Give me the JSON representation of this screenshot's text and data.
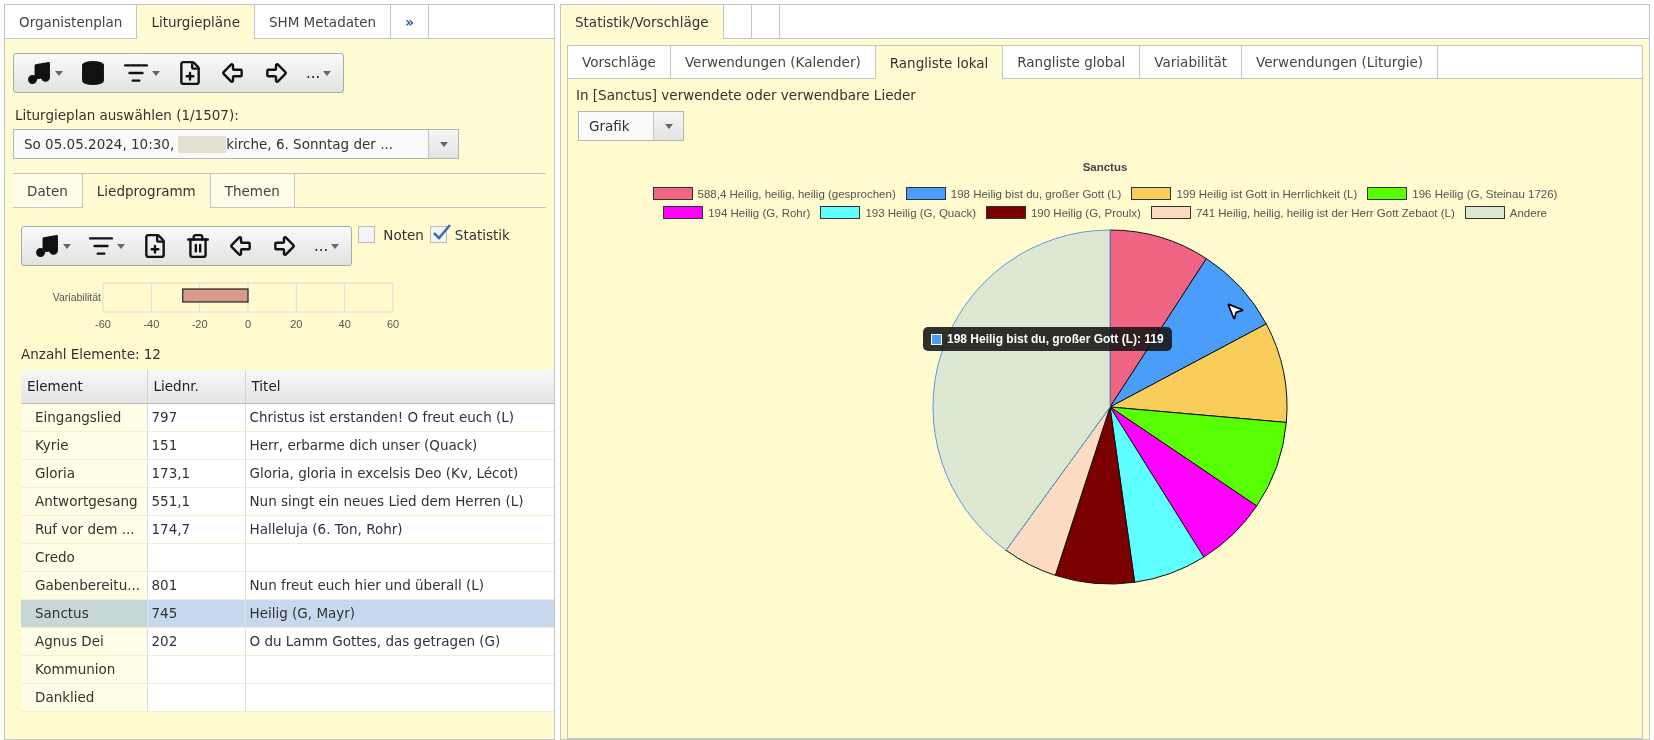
{
  "left": {
    "tabs": [
      {
        "label": "Organistenplan",
        "selected": false
      },
      {
        "label": "Liturgiepläne",
        "selected": true
      },
      {
        "label": "SHM Metadaten",
        "selected": false
      },
      {
        "label": "»",
        "selected": false
      }
    ],
    "toolbar": [
      {
        "kind": "music",
        "dropdown": true
      },
      {
        "kind": "database",
        "dropdown": false
      },
      {
        "kind": "filter",
        "dropdown": true
      },
      {
        "kind": "newfile",
        "dropdown": false
      },
      {
        "kind": "back",
        "dropdown": false
      },
      {
        "kind": "forward",
        "dropdown": false
      },
      {
        "kind": "more",
        "label": "...",
        "dropdown": true
      }
    ],
    "plan_label": "Liturgieplan auswählen (1/1507):",
    "plan_select": {
      "value_parts": [
        "So 05.05.2024, 10:30,",
        "kirche, 6. Sonntag der ..."
      ]
    },
    "subtabs": [
      {
        "label": "Daten",
        "selected": false
      },
      {
        "label": "Liedprogramm",
        "selected": true
      },
      {
        "label": "Themen",
        "selected": false
      }
    ],
    "program_toolbar": [
      {
        "kind": "music",
        "dropdown": true
      },
      {
        "kind": "filter",
        "dropdown": true
      },
      {
        "kind": "newfile",
        "dropdown": false
      },
      {
        "kind": "trash",
        "dropdown": false
      },
      {
        "kind": "back",
        "dropdown": false
      },
      {
        "kind": "forward",
        "dropdown": false
      },
      {
        "kind": "more",
        "label": "...",
        "dropdown": true
      }
    ],
    "options": [
      {
        "label": "Noten",
        "checked": false
      },
      {
        "label": "Statistik",
        "checked": true
      }
    ],
    "variability": {
      "chart_data": {
        "type": "bar",
        "orientation": "horizontal",
        "categories": [
          "Variabilität"
        ],
        "values": [
          -27
        ],
        "xlim": [
          -60,
          60
        ],
        "xticks": [
          -60,
          -40,
          -20,
          0,
          20,
          40,
          60
        ]
      }
    },
    "count": "Anzahl Elemente: 12",
    "table": {
      "columns": [
        "Element",
        "Liednr.",
        "Titel"
      ],
      "rows": [
        {
          "cells": [
            "Eingangslied",
            "797",
            "Christus ist erstanden! O freut euch (L)"
          ],
          "selected": false
        },
        {
          "cells": [
            "Kyrie",
            "151",
            "Herr, erbarme dich unser (Quack)"
          ],
          "selected": false
        },
        {
          "cells": [
            "Gloria",
            "173,1",
            "Gloria, gloria in excelsis Deo (Kv, Lécot)"
          ],
          "selected": false
        },
        {
          "cells": [
            "Antwortgesang",
            "551,1",
            "Nun singt ein neues Lied dem Herren (L)"
          ],
          "selected": false
        },
        {
          "cells": [
            "Ruf vor dem ...",
            "174,7",
            "Halleluja (6. Ton, Rohr)"
          ],
          "selected": false
        },
        {
          "cells": [
            "Credo"
          ],
          "selected": false
        },
        {
          "cells": [
            "Gabenbereitu...",
            "801",
            "Nun freut euch hier und überall (L)"
          ],
          "selected": false
        },
        {
          "cells": [
            "Sanctus",
            "745",
            "Heilig (G, Mayr)"
          ],
          "selected": true
        },
        {
          "cells": [
            "Agnus Dei",
            "202",
            "O du Lamm Gottes, das getragen (G)"
          ],
          "selected": false
        },
        {
          "cells": [
            "Kommunion"
          ],
          "selected": false
        },
        {
          "cells": [
            "Danklied"
          ],
          "selected": false
        }
      ]
    }
  },
  "right": {
    "tabs": [
      {
        "label": "Statistik/Vorschläge",
        "selected": true
      }
    ],
    "subtabs": [
      {
        "label": "Vorschläge",
        "selected": false
      },
      {
        "label": "Verwendungen (Kalender)",
        "selected": false
      },
      {
        "label": "Rangliste lokal",
        "selected": true
      },
      {
        "label": "Rangliste global",
        "selected": false
      },
      {
        "label": "Variabilität",
        "selected": false
      },
      {
        "label": "Verwendungen (Liturgie)",
        "selected": false
      }
    ],
    "caption": "In [Sanctus] verwendete oder verwendbare Lieder",
    "view_select": {
      "value": "Grafik"
    },
    "chart": {
      "title": "Sanctus",
      "legend": [
        {
          "label": "588,4 Heilig, heilig, heilig (gesprochen)",
          "color": "#f06584"
        },
        {
          "label": "198 Heilig bist du, großer Gott (L)",
          "color": "#4a9df8"
        },
        {
          "label": "199 Heilig ist Gott in Herrlichkeit (L)",
          "color": "#f8cd5a"
        },
        {
          "label": "196 Heilig (G, Steinau 1726)",
          "color": "#58ff00"
        },
        {
          "label": "194 Heilig (G, Rohr)",
          "color": "#ff00ff"
        },
        {
          "label": "193 Heilig (G, Quack)",
          "color": "#5fffff"
        },
        {
          "label": "190 Heilig (G, Proulx)",
          "color": "#7a0000"
        },
        {
          "label": "741 Heilig, heilig, heilig ist der Herr Gott Zebaot (L)",
          "color": "#fcdcc0"
        },
        {
          "label": "Andere",
          "color": "#dce8d2"
        }
      ],
      "tooltip": {
        "text": "198 Heilig bist du, großer Gott (L): 119",
        "color": "#4a9df8"
      }
    }
  }
}
